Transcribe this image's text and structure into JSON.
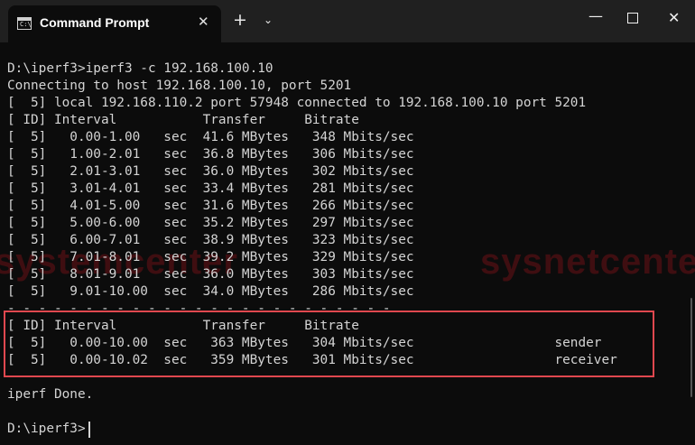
{
  "window": {
    "tab_title": "Command Prompt",
    "tab_icon_text": "C:\\",
    "close_tab_glyph": "✕",
    "new_tab_glyph": "+",
    "dropdown_glyph": "⌄",
    "minimize_glyph": "—",
    "close_glyph": "✕"
  },
  "terminal": {
    "lines": [
      "D:\\iperf3>iperf3 -c 192.168.100.10",
      "Connecting to host 192.168.100.10, port 5201",
      "[  5] local 192.168.110.2 port 57948 connected to 192.168.100.10 port 5201",
      "[ ID] Interval           Transfer     Bitrate",
      "[  5]   0.00-1.00   sec  41.6 MBytes   348 Mbits/sec",
      "[  5]   1.00-2.01   sec  36.8 MBytes   306 Mbits/sec",
      "[  5]   2.01-3.01   sec  36.0 MBytes   302 Mbits/sec",
      "[  5]   3.01-4.01   sec  33.4 MBytes   281 Mbits/sec",
      "[  5]   4.01-5.00   sec  31.6 MBytes   266 Mbits/sec",
      "[  5]   5.00-6.00   sec  35.2 MBytes   297 Mbits/sec",
      "[  5]   6.00-7.01   sec  38.9 MBytes   323 Mbits/sec",
      "[  5]   7.01-8.01   sec  39.2 MBytes   329 Mbits/sec",
      "[  5]   8.01-9.01   sec  36.0 MBytes   303 Mbits/sec",
      "[  5]   9.01-10.00  sec  34.0 MBytes   286 Mbits/sec",
      "- - - - - - - - - - - - - - - - - - - - - - - - -",
      "[ ID] Interval           Transfer     Bitrate",
      "[  5]   0.00-10.00  sec   363 MBytes   304 Mbits/sec                  sender",
      "[  5]   0.00-10.02  sec   359 MBytes   301 Mbits/sec                  receiver",
      "",
      "iperf Done.",
      "",
      "D:\\iperf3>"
    ]
  },
  "watermarks": [
    "systemcenter",
    "sysnetcenter"
  ],
  "colors": {
    "background": "#0c0c0c",
    "text": "#d4d4d4",
    "highlight_border": "#e0484f"
  }
}
